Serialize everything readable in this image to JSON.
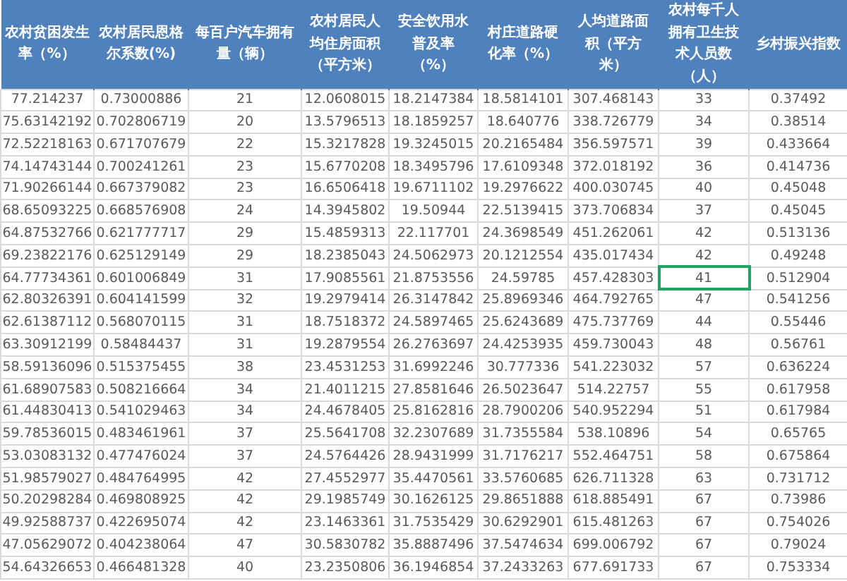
{
  "table": {
    "columns": [
      "农村贫困发生率（%）",
      "农村居民恩格尔系数(%)",
      "每百户汽车拥有量（辆）",
      "农村居民人均住房面积（平方米）",
      "安全饮用水普及率（%）",
      "村庄道路硬化率（%）",
      "人均道路面积（平方米）",
      "农村每千人拥有卫生技术人员数（人）",
      "乡村振兴指数"
    ],
    "rows": [
      [
        {
          "text": "77.214237",
          "selected": false
        },
        {
          "text": "0.73000886",
          "selected": false
        },
        {
          "text": "21",
          "selected": false
        },
        {
          "text": "12.0608015",
          "selected": false
        },
        {
          "text": "18.2147384",
          "selected": false
        },
        {
          "text": "18.5814101",
          "selected": false
        },
        {
          "text": "307.468143",
          "selected": false
        },
        {
          "text": "33",
          "selected": false
        },
        {
          "text": "0.37492",
          "selected": false
        }
      ],
      [
        {
          "text": "75.63142192",
          "selected": false
        },
        {
          "text": "0.702806719",
          "selected": false
        },
        {
          "text": "20",
          "selected": false
        },
        {
          "text": "13.5796513",
          "selected": false
        },
        {
          "text": "18.1859257",
          "selected": false
        },
        {
          "text": "18.640776",
          "selected": false
        },
        {
          "text": "338.726779",
          "selected": false
        },
        {
          "text": "34",
          "selected": false
        },
        {
          "text": "0.38514",
          "selected": false
        }
      ],
      [
        {
          "text": "72.52218163",
          "selected": false
        },
        {
          "text": "0.671707679",
          "selected": false
        },
        {
          "text": "22",
          "selected": false
        },
        {
          "text": "15.3217828",
          "selected": false
        },
        {
          "text": "19.3245015",
          "selected": false
        },
        {
          "text": "20.2165484",
          "selected": false
        },
        {
          "text": "356.597571",
          "selected": false
        },
        {
          "text": "39",
          "selected": false
        },
        {
          "text": "0.433664",
          "selected": false
        }
      ],
      [
        {
          "text": "74.14743144",
          "selected": false
        },
        {
          "text": "0.700241261",
          "selected": false
        },
        {
          "text": "23",
          "selected": false
        },
        {
          "text": "15.6770208",
          "selected": false
        },
        {
          "text": "18.3495796",
          "selected": false
        },
        {
          "text": "17.6109348",
          "selected": false
        },
        {
          "text": "372.018192",
          "selected": false
        },
        {
          "text": "36",
          "selected": false
        },
        {
          "text": "0.414736",
          "selected": false
        }
      ],
      [
        {
          "text": "71.90266144",
          "selected": false
        },
        {
          "text": "0.667379082",
          "selected": false
        },
        {
          "text": "23",
          "selected": false
        },
        {
          "text": "16.6506418",
          "selected": false
        },
        {
          "text": "19.6711102",
          "selected": false
        },
        {
          "text": "19.2976622",
          "selected": false
        },
        {
          "text": "400.030745",
          "selected": false
        },
        {
          "text": "40",
          "selected": false
        },
        {
          "text": "0.45048",
          "selected": false
        }
      ],
      [
        {
          "text": "68.65093225",
          "selected": false
        },
        {
          "text": "0.668576908",
          "selected": false
        },
        {
          "text": "24",
          "selected": false
        },
        {
          "text": "14.3945802",
          "selected": false
        },
        {
          "text": "19.50944",
          "selected": false
        },
        {
          "text": "22.5139415",
          "selected": false
        },
        {
          "text": "373.706834",
          "selected": false
        },
        {
          "text": "37",
          "selected": false
        },
        {
          "text": "0.45045",
          "selected": false
        }
      ],
      [
        {
          "text": "64.87532766",
          "selected": false
        },
        {
          "text": "0.621777717",
          "selected": false
        },
        {
          "text": "29",
          "selected": false
        },
        {
          "text": "15.4859313",
          "selected": false
        },
        {
          "text": "22.117701",
          "selected": false
        },
        {
          "text": "24.3698549",
          "selected": false
        },
        {
          "text": "451.262061",
          "selected": false
        },
        {
          "text": "42",
          "selected": false
        },
        {
          "text": "0.513136",
          "selected": false
        }
      ],
      [
        {
          "text": "69.23822176",
          "selected": false
        },
        {
          "text": "0.625129149",
          "selected": false
        },
        {
          "text": "29",
          "selected": false
        },
        {
          "text": "18.2385043",
          "selected": false
        },
        {
          "text": "24.5062973",
          "selected": false
        },
        {
          "text": "20.1212554",
          "selected": false
        },
        {
          "text": "435.017434",
          "selected": false
        },
        {
          "text": "42",
          "selected": false
        },
        {
          "text": "0.49248",
          "selected": false
        }
      ],
      [
        {
          "text": "64.77734361",
          "selected": false
        },
        {
          "text": "0.601006849",
          "selected": false
        },
        {
          "text": "31",
          "selected": false
        },
        {
          "text": "17.9085561",
          "selected": false
        },
        {
          "text": "21.8753556",
          "selected": false
        },
        {
          "text": "24.59785",
          "selected": false
        },
        {
          "text": "457.428303",
          "selected": false
        },
        {
          "text": "41",
          "selected": true
        },
        {
          "text": "0.512904",
          "selected": false
        }
      ],
      [
        {
          "text": "62.80326391",
          "selected": false
        },
        {
          "text": "0.604141599",
          "selected": false
        },
        {
          "text": "32",
          "selected": false
        },
        {
          "text": "19.2979414",
          "selected": false
        },
        {
          "text": "26.3147842",
          "selected": false
        },
        {
          "text": "25.8969346",
          "selected": false
        },
        {
          "text": "464.792765",
          "selected": false
        },
        {
          "text": "47",
          "selected": false
        },
        {
          "text": "0.541256",
          "selected": false
        }
      ],
      [
        {
          "text": "62.61387112",
          "selected": false
        },
        {
          "text": "0.568070115",
          "selected": false
        },
        {
          "text": "31",
          "selected": false
        },
        {
          "text": "18.7518372",
          "selected": false
        },
        {
          "text": "24.5897465",
          "selected": false
        },
        {
          "text": "25.6243689",
          "selected": false
        },
        {
          "text": "475.737769",
          "selected": false
        },
        {
          "text": "44",
          "selected": false
        },
        {
          "text": "0.55446",
          "selected": false
        }
      ],
      [
        {
          "text": "63.30912199",
          "selected": false
        },
        {
          "text": "0.58484437",
          "selected": false
        },
        {
          "text": "31",
          "selected": false
        },
        {
          "text": "19.2879554",
          "selected": false
        },
        {
          "text": "26.2763697",
          "selected": false
        },
        {
          "text": "24.4253935",
          "selected": false
        },
        {
          "text": "459.730043",
          "selected": false
        },
        {
          "text": "48",
          "selected": false
        },
        {
          "text": "0.56761",
          "selected": false
        }
      ],
      [
        {
          "text": "58.59136096",
          "selected": false
        },
        {
          "text": "0.515375455",
          "selected": false
        },
        {
          "text": "38",
          "selected": false
        },
        {
          "text": "23.4531253",
          "selected": false
        },
        {
          "text": "31.6992246",
          "selected": false
        },
        {
          "text": "30.777336",
          "selected": false
        },
        {
          "text": "541.223032",
          "selected": false
        },
        {
          "text": "57",
          "selected": false
        },
        {
          "text": "0.636224",
          "selected": false
        }
      ],
      [
        {
          "text": "61.68907583",
          "selected": false
        },
        {
          "text": "0.508216664",
          "selected": false
        },
        {
          "text": "34",
          "selected": false
        },
        {
          "text": "21.4011215",
          "selected": false
        },
        {
          "text": "27.8581646",
          "selected": false
        },
        {
          "text": "26.5023647",
          "selected": false
        },
        {
          "text": "514.22757",
          "selected": false
        },
        {
          "text": "55",
          "selected": false
        },
        {
          "text": "0.617958",
          "selected": false
        }
      ],
      [
        {
          "text": "61.44830413",
          "selected": false
        },
        {
          "text": "0.541029463",
          "selected": false
        },
        {
          "text": "34",
          "selected": false
        },
        {
          "text": "24.4678405",
          "selected": false
        },
        {
          "text": "25.8162816",
          "selected": false
        },
        {
          "text": "28.7900206",
          "selected": false
        },
        {
          "text": "540.952294",
          "selected": false
        },
        {
          "text": "51",
          "selected": false
        },
        {
          "text": "0.617984",
          "selected": false
        }
      ],
      [
        {
          "text": "59.78536015",
          "selected": false
        },
        {
          "text": "0.483461961",
          "selected": false
        },
        {
          "text": "37",
          "selected": false
        },
        {
          "text": "25.5641708",
          "selected": false
        },
        {
          "text": "32.2307689",
          "selected": false
        },
        {
          "text": "31.7355584",
          "selected": false
        },
        {
          "text": "538.10896",
          "selected": false
        },
        {
          "text": "54",
          "selected": false
        },
        {
          "text": "0.65765",
          "selected": false
        }
      ],
      [
        {
          "text": "53.03083132",
          "selected": false
        },
        {
          "text": "0.477476024",
          "selected": false
        },
        {
          "text": "37",
          "selected": false
        },
        {
          "text": "24.5764426",
          "selected": false
        },
        {
          "text": "28.9431999",
          "selected": false
        },
        {
          "text": "31.7176217",
          "selected": false
        },
        {
          "text": "552.464751",
          "selected": false
        },
        {
          "text": "58",
          "selected": false
        },
        {
          "text": "0.675864",
          "selected": false
        }
      ],
      [
        {
          "text": "51.98579027",
          "selected": false
        },
        {
          "text": "0.484764995",
          "selected": false
        },
        {
          "text": "42",
          "selected": false
        },
        {
          "text": "27.4552977",
          "selected": false
        },
        {
          "text": "35.4470561",
          "selected": false
        },
        {
          "text": "33.5760685",
          "selected": false
        },
        {
          "text": "626.711328",
          "selected": false
        },
        {
          "text": "63",
          "selected": false
        },
        {
          "text": "0.731712",
          "selected": false
        }
      ],
      [
        {
          "text": "50.20298284",
          "selected": false
        },
        {
          "text": "0.469808925",
          "selected": false
        },
        {
          "text": "42",
          "selected": false
        },
        {
          "text": "29.1985749",
          "selected": false
        },
        {
          "text": "30.1626125",
          "selected": false
        },
        {
          "text": "29.8651888",
          "selected": false
        },
        {
          "text": "618.885491",
          "selected": false
        },
        {
          "text": "67",
          "selected": false
        },
        {
          "text": "0.73986",
          "selected": false
        }
      ],
      [
        {
          "text": "49.92588737",
          "selected": false
        },
        {
          "text": "0.422695074",
          "selected": false
        },
        {
          "text": "42",
          "selected": false
        },
        {
          "text": "23.1463361",
          "selected": false
        },
        {
          "text": "31.7535429",
          "selected": false
        },
        {
          "text": "30.6292901",
          "selected": false
        },
        {
          "text": "615.481263",
          "selected": false
        },
        {
          "text": "67",
          "selected": false
        },
        {
          "text": "0.754026",
          "selected": false
        }
      ],
      [
        {
          "text": "47.05629072",
          "selected": false
        },
        {
          "text": "0.404238064",
          "selected": false
        },
        {
          "text": "47",
          "selected": false
        },
        {
          "text": "30.5830782",
          "selected": false
        },
        {
          "text": "35.8887496",
          "selected": false
        },
        {
          "text": "37.5474634",
          "selected": false
        },
        {
          "text": "699.006792",
          "selected": false
        },
        {
          "text": "67",
          "selected": false
        },
        {
          "text": "0.79024",
          "selected": false
        }
      ],
      [
        {
          "text": "54.64326653",
          "selected": false
        },
        {
          "text": "0.466481328",
          "selected": false
        },
        {
          "text": "40",
          "selected": false
        },
        {
          "text": "23.2350806",
          "selected": false
        },
        {
          "text": "36.1946854",
          "selected": false
        },
        {
          "text": "37.2433263",
          "selected": false
        },
        {
          "text": "677.691733",
          "selected": false
        },
        {
          "text": "67",
          "selected": false
        },
        {
          "text": "0.753334",
          "selected": false
        }
      ]
    ]
  }
}
